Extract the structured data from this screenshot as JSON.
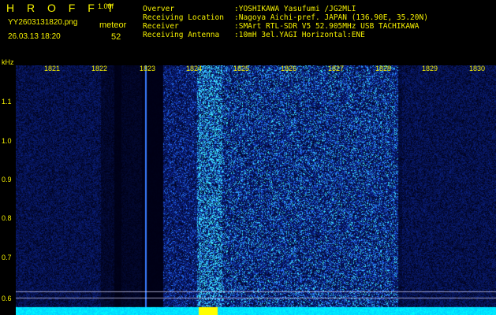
{
  "header": {
    "app_title": "H R O F F T",
    "version": "1.00f",
    "filename": "YY2603131820.png",
    "meteor_label": "meteor",
    "datetime": "26.03.13 18:20",
    "meteor_count": "52"
  },
  "info": {
    "labels": [
      "Overver",
      "Receiving Location",
      "Receiver",
      "Receiving Antenna"
    ],
    "values": [
      ":YOSHIKAWA Yasufumi /JG2MLI",
      ":Nagoya Aichi-pref. JAPAN (136.90E, 35.20N)",
      ":SMArt RTL-SDR V5 52.905MHz USB TACHIKAWA",
      ":10mH 3el.YAGI Horizontal:ENE"
    ]
  },
  "axes": {
    "unit": "kHz",
    "y_ticks": [
      "1.1",
      "1.0",
      "0.9",
      "0.8",
      "0.7",
      "0.6"
    ],
    "x_ticks": [
      "1821",
      "1822",
      "1823",
      "1824",
      "1825",
      "1826",
      "1827",
      "1828",
      "1829",
      "1830"
    ]
  },
  "colors": {
    "background": "#000000",
    "label_yellow": "#f5f000",
    "band_dark": "#12165a",
    "band_bright": "#2a3cc8",
    "meteor_cyan": "#4fe0ff",
    "baseline_cyan": "#00e5ff",
    "baseline_yellow": "#ffff00"
  }
}
